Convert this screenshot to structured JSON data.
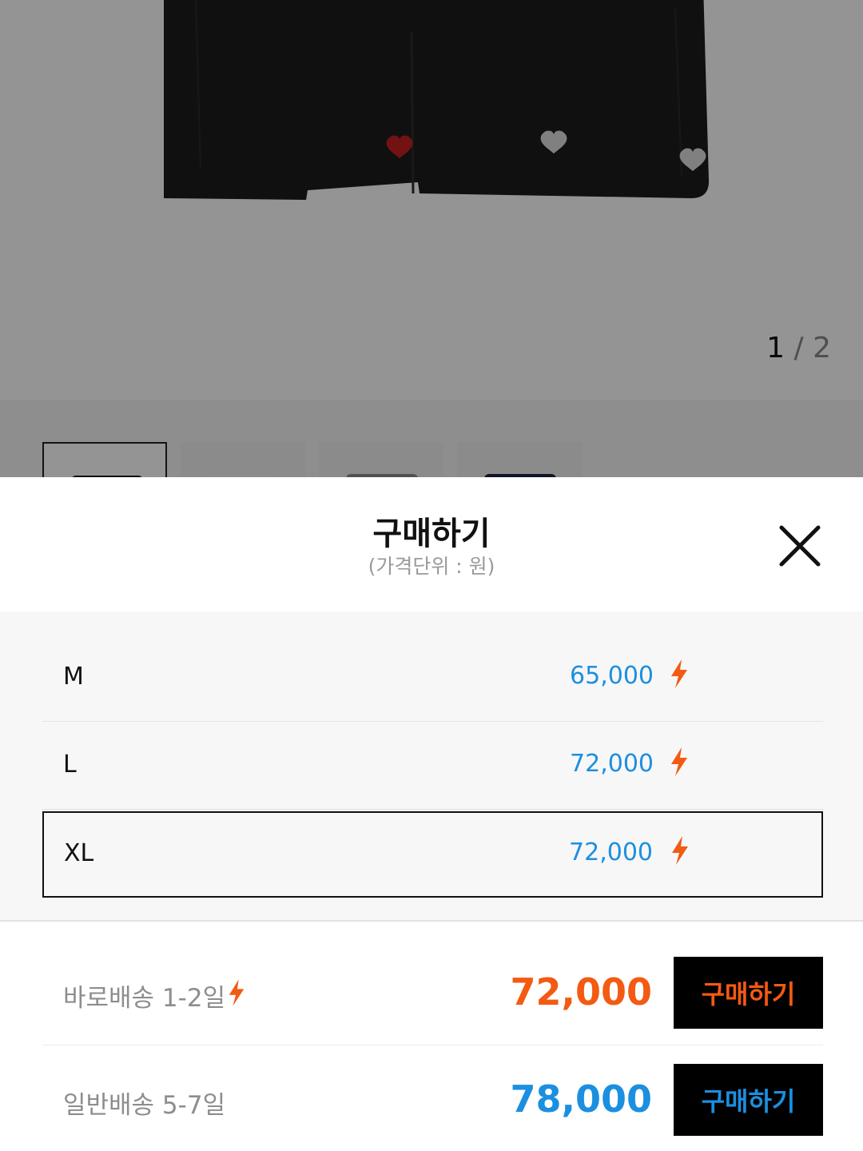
{
  "gallery": {
    "current_page": "1",
    "separator": "/",
    "total_pages": "2"
  },
  "sheet": {
    "title": "구매하기",
    "subtitle": "(가격단위 : 원)"
  },
  "options": [
    {
      "size": "M",
      "price": "65,000",
      "fast_icon": "lightning-icon",
      "selected": false
    },
    {
      "size": "L",
      "price": "72,000",
      "fast_icon": "lightning-icon",
      "selected": false
    },
    {
      "size": "XL",
      "price": "72,000",
      "fast_icon": "lightning-icon",
      "selected": true
    }
  ],
  "shipping": {
    "fast": {
      "label": "바로배송 1-2일",
      "icon": "lightning-icon",
      "price": "72,000",
      "button": "구매하기",
      "color": "#f35a12"
    },
    "normal": {
      "label": "일반배송 5-7일",
      "price": "78,000",
      "button": "구매하기",
      "color": "#1b8fe0"
    }
  },
  "colors": {
    "accent_orange": "#f35a12",
    "accent_blue": "#1b8fe0",
    "button_bg": "#000000"
  }
}
